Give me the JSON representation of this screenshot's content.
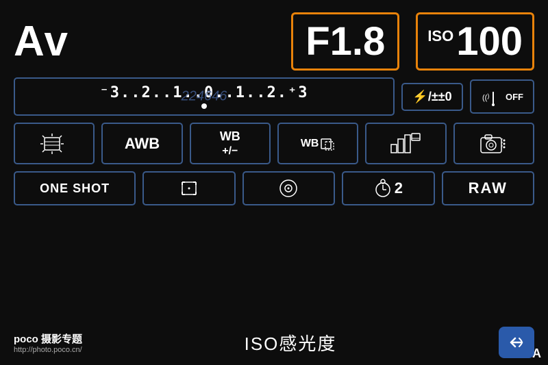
{
  "mode": {
    "label": "Av"
  },
  "aperture": {
    "value": "F1.8"
  },
  "iso": {
    "label": "ISO",
    "value": "100"
  },
  "exposure": {
    "scale": "⁻3..2..1..0..1..2.⁺3",
    "indicator": "·"
  },
  "flash": {
    "label": "±0",
    "icon": "⚡±"
  },
  "wifi": {
    "label": "OFF"
  },
  "metering": {
    "label": "A"
  },
  "wb": {
    "label": "AWB"
  },
  "wb_adj": {
    "line1": "WB",
    "line2": "+/-"
  },
  "wb_bracket": {
    "label": "WB"
  },
  "image_quality": {
    "label": "IMG"
  },
  "camera_mode": {
    "label": "CAM"
  },
  "focus_mode": {
    "label": "ONE SHOT"
  },
  "focus_point": {
    "label": "□"
  },
  "metering2": {
    "label": "⊙"
  },
  "timer": {
    "label": "2"
  },
  "raw": {
    "label": "RAW"
  },
  "bottom": {
    "iso_label": "ISO感光度",
    "poco_brand": "poco 摄影专题",
    "poco_url": "http://photo.poco.cn/"
  },
  "colors": {
    "orange": "#e8820a",
    "blue_border": "#3a5a8a",
    "back_btn": "#2a5aaa",
    "watermark": "#4a6aaa",
    "bg": "#0d0d0d"
  }
}
